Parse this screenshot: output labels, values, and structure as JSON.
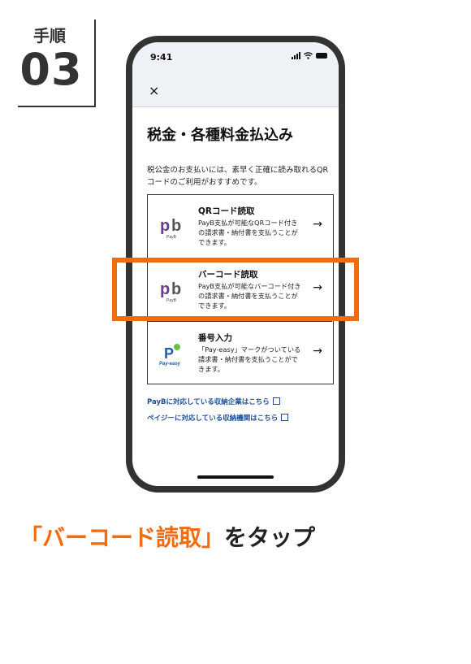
{
  "step": {
    "label": "手順",
    "number": "03"
  },
  "phone": {
    "time": "9:41",
    "close": "×",
    "title": "税金・各種料金払込み",
    "lead": "税公金のお支払いには、素早く正確に読み取れるQRコードのご利用がおすすめです。",
    "options": [
      {
        "logo": "pb",
        "logo_sub": "PayB",
        "title": "QRコード読取",
        "desc": "PayB支払が可能なQRコード付きの請求書・納付書を支払うことができます。"
      },
      {
        "logo": "pb",
        "logo_sub": "PayB",
        "title": "バーコード読取",
        "desc": "PayB支払が可能なバーコード付きの請求書・納付書を支払うことができます。"
      },
      {
        "logo": "P",
        "logo_sub": "Pay-easy",
        "title": "番号入力",
        "desc": "「Pay-easy」マークがついている請求書・納付書を支払うことができます。"
      }
    ],
    "arrow": "→",
    "links": [
      "PayBに対応している収納企業はこちら",
      "ペイジーに対応している収納機関はこちら"
    ]
  },
  "caption": {
    "accent": "「バーコード読取」",
    "rest": "をタップ"
  },
  "colors": {
    "accent": "#f26b0f",
    "link": "#1b4f9c",
    "frame": "#333333"
  }
}
